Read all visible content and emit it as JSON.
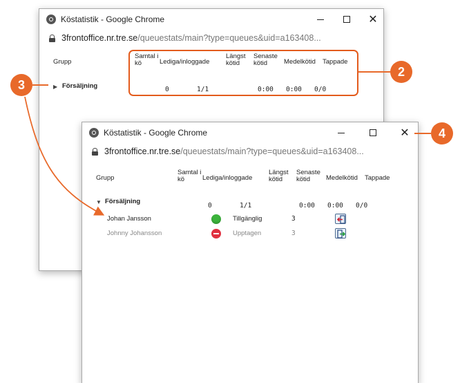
{
  "windows": {
    "back": {
      "title": "Köstatistik - Google Chrome",
      "url_host": "3frontoffice.nr.tre.se",
      "url_path": "/queuestats/main?type=queues&uid=a163408...",
      "headers": {
        "grupp": "Grupp",
        "samtal_line1": "Samtal i",
        "samtal_line2": "kö",
        "lediga": "Lediga/inloggade",
        "langst_line1": "Längst",
        "langst_line2": "kötid",
        "senaste_line1": "Senaste",
        "senaste_line2": "kötid",
        "medel": "Medelkötid",
        "tappade": "Tappade"
      },
      "group": {
        "name": "Försäljning",
        "samtal": "0",
        "lediga": "1/1",
        "langst": "0:00",
        "senaste": "0:00",
        "tappade": "0/0"
      }
    },
    "front": {
      "title": "Köstatistik - Google Chrome",
      "url_host": "3frontoffice.nr.tre.se",
      "url_path": "/queuestats/main?type=queues&uid=a163408...",
      "headers": {
        "grupp": "Grupp",
        "samtal_line1": "Samtal i",
        "samtal_line2": "kö",
        "lediga": "Lediga/inloggade",
        "langst_line1": "Längst",
        "langst_line2": "kötid",
        "senaste_line1": "Senaste",
        "senaste_line2": "kötid",
        "medel": "Medelkötid",
        "tappade": "Tappade"
      },
      "group": {
        "name": "Försäljning",
        "samtal": "0",
        "lediga": "1/1",
        "langst": "0:00",
        "senaste": "0:00",
        "tappade": "0/0"
      },
      "agents": [
        {
          "name": "Johan Jansson",
          "status": "Tillgänglig",
          "count": "3",
          "status_color": "#3cb43c"
        },
        {
          "name": "Johnny Johansson",
          "status": "Upptagen",
          "count": "3",
          "status_color": "#e03040"
        }
      ]
    }
  },
  "callouts": {
    "c2": "2",
    "c3": "3",
    "c4": "4"
  },
  "colors": {
    "accent": "#e8692a"
  }
}
